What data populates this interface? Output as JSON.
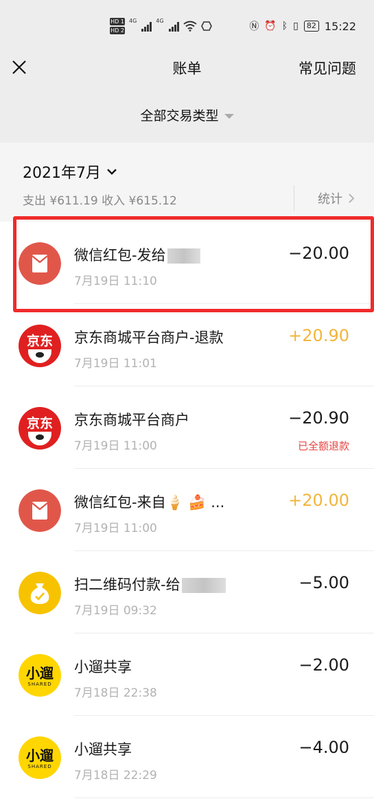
{
  "status_bar": {
    "hd1": "HD 1",
    "hd2": "HD 2",
    "net1": "4G",
    "net2": "4G",
    "battery": "82",
    "time": "15:22"
  },
  "nav": {
    "title": "账单",
    "help": "常见问题"
  },
  "filter": {
    "label": "全部交易类型"
  },
  "summary": {
    "month": "2021年7月",
    "totals": "支出 ¥611.19 收入 ¥615.12",
    "stats_label": "统计"
  },
  "colors": {
    "highlight_border": "#f02b2b",
    "income_amount": "#f2b53a",
    "refund_note": "#e64340",
    "wechat_red": "#e0574a",
    "jd_red": "#e02020",
    "qrpay_yellow": "#f7c300",
    "xiaoliu_yellow": "#ffd600"
  },
  "transactions": [
    {
      "icon": "red-packet-icon",
      "title": "微信红包-发给",
      "blurred": true,
      "time": "7月19日 11:10",
      "amount": "−20.00",
      "type": "expense",
      "note": ""
    },
    {
      "icon": "jd-logo-icon",
      "logo_text": "京东",
      "title": "京东商城平台商户-退款",
      "time": "7月19日 11:01",
      "amount": "+20.90",
      "type": "income",
      "note": ""
    },
    {
      "icon": "jd-logo-icon",
      "logo_text": "京东",
      "title": "京东商城平台商户",
      "time": "7月19日 11:00",
      "amount": "−20.90",
      "type": "expense",
      "note": "已全额退款"
    },
    {
      "icon": "red-packet-icon",
      "title": "微信红包-来自🍦 🍰 ...",
      "time": "7月19日 11:00",
      "amount": "+20.00",
      "type": "income",
      "note": ""
    },
    {
      "icon": "money-bag-icon",
      "title": "扫二维码付款-给",
      "blurred": true,
      "time": "7月19日 09:32",
      "amount": "−5.00",
      "type": "expense",
      "note": ""
    },
    {
      "icon": "xiaoliu-logo-icon",
      "logo_text": "小遛",
      "logo_sub": "SHARED",
      "title": "小遛共享",
      "time": "7月18日 22:38",
      "amount": "−2.00",
      "type": "expense",
      "note": ""
    },
    {
      "icon": "xiaoliu-logo-icon",
      "logo_text": "小遛",
      "logo_sub": "SHARED",
      "title": "小遛共享",
      "time": "7月18日 22:29",
      "amount": "−4.00",
      "type": "expense",
      "note": ""
    }
  ]
}
